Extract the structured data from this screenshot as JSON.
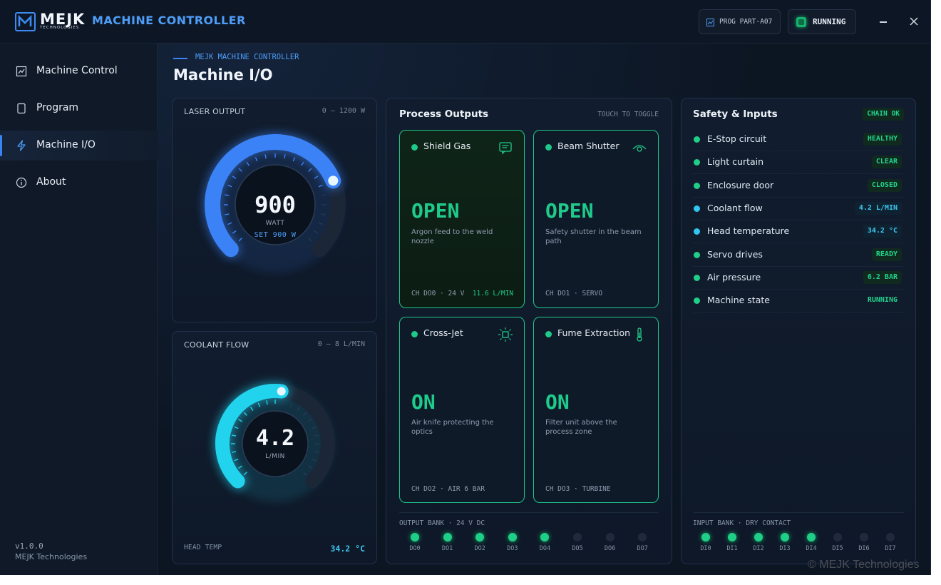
{
  "titlebar": {
    "brand": "MEJK",
    "brand_sub": "TECHNOLOGIES",
    "app_title": "MACHINE CONTROLLER",
    "program_chip": "PROG PART-A07",
    "status_chip": "RUNNING"
  },
  "sidebar": {
    "items": [
      {
        "label": "Machine Control",
        "icon": "chart-icon"
      },
      {
        "label": "Program",
        "icon": "document-icon"
      },
      {
        "label": "Machine I/O",
        "icon": "lightning-icon",
        "active": true
      },
      {
        "label": "About",
        "icon": "info-icon"
      }
    ],
    "version": "v1.0.0",
    "company": "MEJK Technologies"
  },
  "main": {
    "breadcrumb": "MEJK MACHINE CONTROLLER",
    "title": "Machine I/O"
  },
  "laser": {
    "header": "LASER OUTPUT",
    "range": "0 — 1200 W",
    "value": "900",
    "unit": "WATT",
    "setpoint": "SET 900 W",
    "fraction": 0.75,
    "color": "#3b82f6"
  },
  "coolant": {
    "header": "COOLANT FLOW",
    "range": "0 — 8 L/MIN",
    "value": "4.2",
    "unit": "L/MIN",
    "fraction": 0.525,
    "color": "#22d3ee",
    "footer_label": "HEAD TEMP",
    "footer_value": "34.2 °C"
  },
  "outputs": {
    "title": "Process Outputs",
    "hint": "TOUCH TO TOGGLE",
    "tiles": [
      {
        "name": "Shield Gas",
        "state": "OPEN",
        "desc": "Argon feed to the weld nozzle",
        "channel": "CH DO0 · 24 V",
        "extra": "11.6 L/MIN",
        "icon": "message-icon"
      },
      {
        "name": "Beam Shutter",
        "state": "OPEN",
        "desc": "Safety shutter in the beam path",
        "channel": "CH DO1 · SERVO",
        "extra": "",
        "icon": "eye-icon"
      },
      {
        "name": "Cross-Jet",
        "state": "ON",
        "desc": "Air knife protecting the optics",
        "channel": "CH DO2 · AIR 6 BAR",
        "extra": "",
        "icon": "sun-icon"
      },
      {
        "name": "Fume Extraction",
        "state": "ON",
        "desc": "Filter unit above the process zone",
        "channel": "CH DO3 · TURBINE",
        "extra": "",
        "icon": "thermometer-icon"
      }
    ],
    "bank_label": "OUTPUT BANK · 24 V DC",
    "bank": [
      {
        "label": "DO0",
        "on": true
      },
      {
        "label": "DO1",
        "on": true
      },
      {
        "label": "DO2",
        "on": true
      },
      {
        "label": "DO3",
        "on": true
      },
      {
        "label": "DO4",
        "on": true
      },
      {
        "label": "DO5",
        "on": false
      },
      {
        "label": "DO6",
        "on": false
      },
      {
        "label": "DO7",
        "on": false
      }
    ]
  },
  "safety": {
    "title": "Safety & Inputs",
    "badge": "CHAIN OK",
    "rows": [
      {
        "label": "E-Stop circuit",
        "value": "HEALTHY",
        "tone": "green"
      },
      {
        "label": "Light curtain",
        "value": "CLEAR",
        "tone": "green"
      },
      {
        "label": "Enclosure door",
        "value": "CLOSED",
        "tone": "green"
      },
      {
        "label": "Coolant flow",
        "value": "4.2 L/MIN",
        "tone": "cyan"
      },
      {
        "label": "Head temperature",
        "value": "34.2 °C",
        "tone": "cyan"
      },
      {
        "label": "Servo drives",
        "value": "READY",
        "tone": "green"
      },
      {
        "label": "Air pressure",
        "value": "6.2 BAR",
        "tone": "green"
      },
      {
        "label": "Machine state",
        "value": "RUNNING",
        "tone": "plain"
      }
    ],
    "bank_label": "INPUT BANK · DRY CONTACT",
    "bank": [
      {
        "label": "DI0",
        "on": true
      },
      {
        "label": "DI1",
        "on": true
      },
      {
        "label": "DI2",
        "on": true
      },
      {
        "label": "DI3",
        "on": true
      },
      {
        "label": "DI4",
        "on": true
      },
      {
        "label": "DI5",
        "on": false
      },
      {
        "label": "DI6",
        "on": false
      },
      {
        "label": "DI7",
        "on": false
      }
    ]
  },
  "copyright": "© MEJK Technologies"
}
